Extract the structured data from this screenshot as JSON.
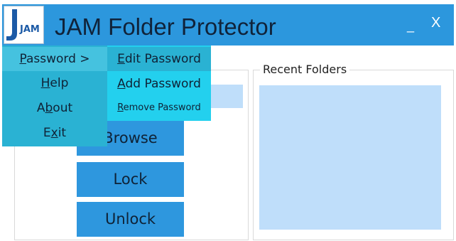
{
  "window": {
    "title": "JAM Folder Protector",
    "minimize_label": "_",
    "close_label": "X",
    "logo_text": "JAM"
  },
  "menu": {
    "items": [
      {
        "pre": "",
        "key": "P",
        "post": "assword >"
      },
      {
        "pre": "",
        "key": "H",
        "post": "elp"
      },
      {
        "pre": "A",
        "key": "b",
        "post": "out"
      },
      {
        "pre": "E",
        "key": "x",
        "post": "it"
      }
    ]
  },
  "password_submenu": {
    "items": [
      {
        "pre": "",
        "key": "E",
        "post": "dit Password"
      },
      {
        "pre": "",
        "key": "A",
        "post": "dd Password"
      },
      {
        "pre": "",
        "key": "R",
        "post": "emove Password"
      }
    ]
  },
  "actions": {
    "browse_label": "Browse",
    "lock_label": "Lock",
    "unlock_label": "Unlock"
  },
  "recent": {
    "label": "Recent Folders"
  },
  "colors": {
    "titlebar": "#2c97dd",
    "menu": "#2ab2d3",
    "menu_highlight": "#45c2df",
    "submenu": "#23d0ee",
    "button": "#2e97de",
    "list": "#bfdefa"
  }
}
